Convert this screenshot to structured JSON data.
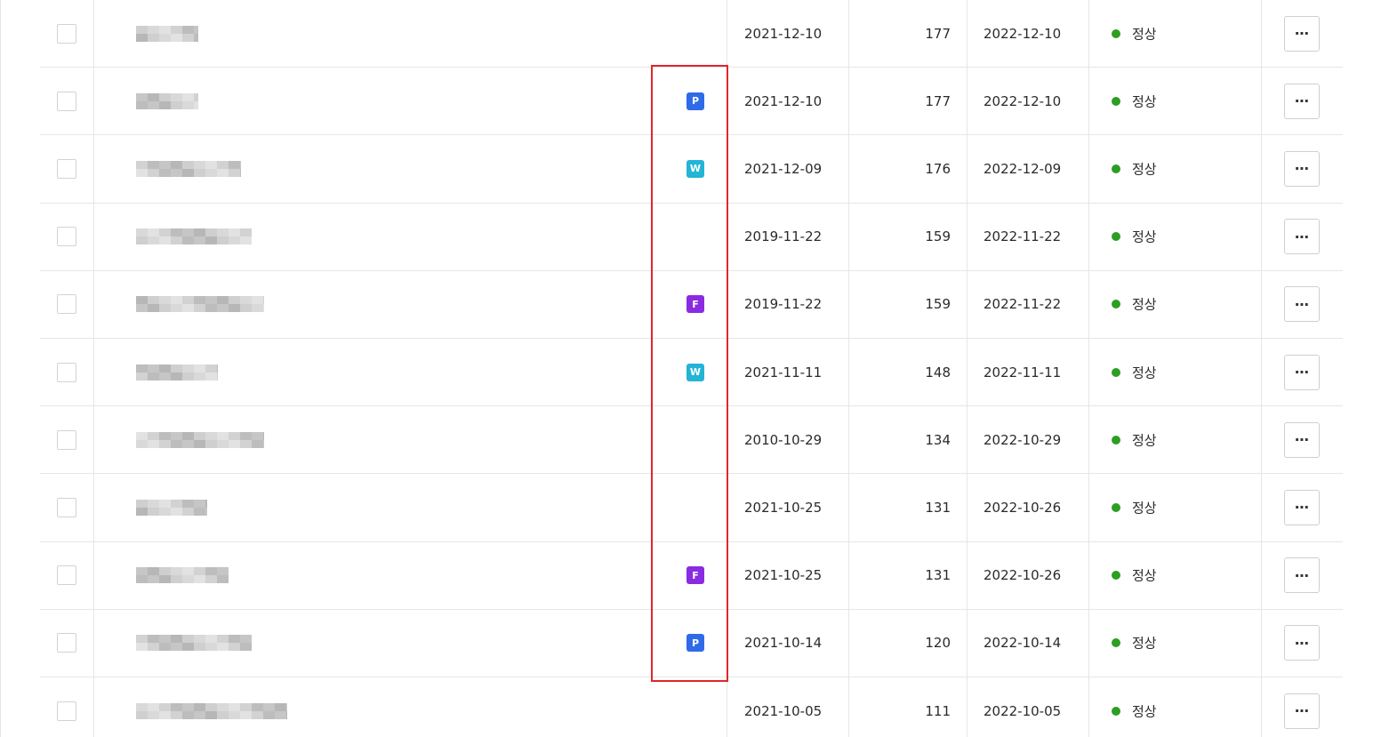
{
  "colors": {
    "status_ok": "#2e9e22",
    "badge_P": "#2f6be8",
    "badge_W": "#23b4d6",
    "badge_F": "#8a2be2",
    "highlight": "#e0262e"
  },
  "more_icon": "⋯",
  "rows": [
    {
      "badge": "",
      "start": "2021-12-10",
      "count": "177",
      "end": "2022-12-10",
      "status": "정상"
    },
    {
      "badge": "P",
      "start": "2021-12-10",
      "count": "177",
      "end": "2022-12-10",
      "status": "정상"
    },
    {
      "badge": "W",
      "start": "2021-12-09",
      "count": "176",
      "end": "2022-12-09",
      "status": "정상"
    },
    {
      "badge": "",
      "start": "2019-11-22",
      "count": "159",
      "end": "2022-11-22",
      "status": "정상"
    },
    {
      "badge": "F",
      "start": "2019-11-22",
      "count": "159",
      "end": "2022-11-22",
      "status": "정상"
    },
    {
      "badge": "W",
      "start": "2021-11-11",
      "count": "148",
      "end": "2022-11-11",
      "status": "정상"
    },
    {
      "badge": "",
      "start": "2010-10-29",
      "count": "134",
      "end": "2022-10-29",
      "status": "정상"
    },
    {
      "badge": "",
      "start": "2021-10-25",
      "count": "131",
      "end": "2022-10-26",
      "status": "정상"
    },
    {
      "badge": "F",
      "start": "2021-10-25",
      "count": "131",
      "end": "2022-10-26",
      "status": "정상"
    },
    {
      "badge": "P",
      "start": "2021-10-14",
      "count": "120",
      "end": "2022-10-14",
      "status": "정상"
    },
    {
      "badge": "",
      "start": "2021-10-05",
      "count": "111",
      "end": "2022-10-05",
      "status": "정상"
    }
  ]
}
